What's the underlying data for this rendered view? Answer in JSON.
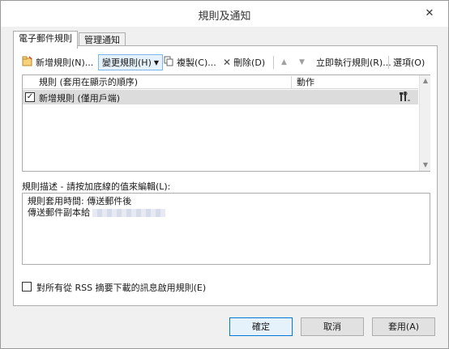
{
  "window": {
    "title": "規則及通知",
    "close_glyph": "✕"
  },
  "tabs": [
    {
      "label": "電子郵件規則",
      "active": true
    },
    {
      "label": "管理通知",
      "active": false
    }
  ],
  "toolbar": {
    "new_rule": "新增規則(N)...",
    "change_rule": "變更規則(H)",
    "copy": "複製(C)...",
    "delete": "刪除(D)",
    "run_rules_now": "立即執行規則(R)...",
    "options": "選項(O)"
  },
  "rules_list": {
    "columns": [
      "規則 (套用在顯示的順序)",
      "動作"
    ],
    "rows": [
      {
        "checked": true,
        "name": "新增規則 (僅用戶端)",
        "action_icon": "wrench-screwdriver-icon"
      }
    ]
  },
  "description": {
    "label": "規則描述 - 請按加底線的值來編輯(L):",
    "lines": [
      "規則套用時間: 傳送郵件後",
      "傳送郵件副本給"
    ]
  },
  "rss_option": {
    "checked": false,
    "label": "對所有從 RSS 摘要下載的訊息啟用規則(E)"
  },
  "buttons": {
    "ok": "確定",
    "cancel": "取消",
    "apply": "套用(A)"
  },
  "colors": {
    "accent": "#0078d7",
    "selected_row": "#dcdcdc",
    "dialog_bg": "#f0f0f0"
  }
}
